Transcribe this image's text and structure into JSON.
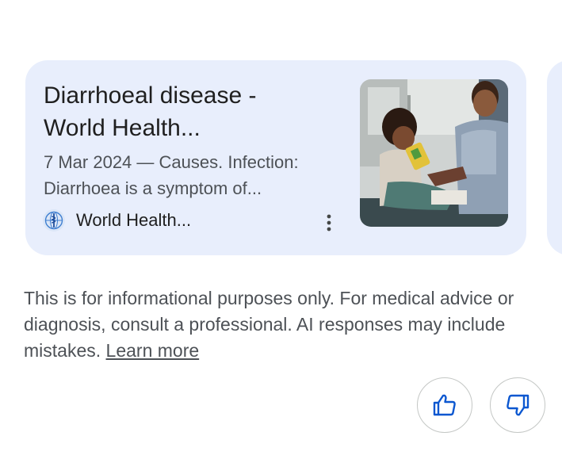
{
  "result_card": {
    "title": "Diarrhoeal disease -\nWorld Health...",
    "snippet": "7 Mar 2024 — Causes. Infection:\nDiarrhoea is a symptom of...",
    "source_name": "World Health...",
    "source_icon": "who-logo-icon",
    "more_icon": "more-vert-icon"
  },
  "disclaimer": {
    "text": "This is for informational purposes only. For medical advice or diagnosis, consult a professional. AI responses may include mistakes. ",
    "link_label": "Learn more"
  },
  "feedback": {
    "thumbs_up_icon": "thumbs-up-icon",
    "thumbs_down_icon": "thumbs-down-icon"
  },
  "colors": {
    "card_background": "#e8eefc",
    "primary_text": "#1f1f1f",
    "secondary_text": "#4d5156",
    "accent_blue": "#0b57d0"
  }
}
